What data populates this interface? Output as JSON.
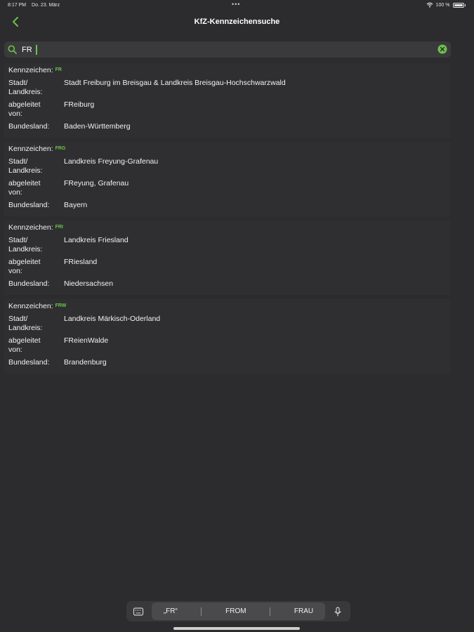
{
  "status_bar": {
    "time": "8:17 PM",
    "date": "Do. 23. März",
    "dots": "•••",
    "battery": "100 %"
  },
  "nav": {
    "title": "KfZ-Kennzeichensuche"
  },
  "search": {
    "value": "FR"
  },
  "labels": {
    "kennzeichen": "Kennzeichen:",
    "stadt_line1": "Stadt/",
    "stadt_line2": "Landkreis:",
    "abgeleitet_line1": "abgeleitet",
    "abgeleitet_line2": "von:",
    "bundesland": "Bundesland:"
  },
  "results": [
    {
      "code": "FR",
      "stadt": "Stadt Freiburg im Breisgau & Landkreis Breisgau-Hochschwarzwald",
      "abgeleitet": "FReiburg",
      "bundesland": "Baden-Württemberg"
    },
    {
      "code": "FRG",
      "stadt": "Landkreis Freyung-Grafenau",
      "abgeleitet": "FReyung, Grafenau",
      "bundesland": "Bayern"
    },
    {
      "code": "FRI",
      "stadt": "Landkreis Friesland",
      "abgeleitet": "FRiesland",
      "bundesland": "Niedersachsen"
    },
    {
      "code": "FRW",
      "stadt": "Landkreis Märkisch-Oderland",
      "abgeleitet": "FReienWalde",
      "bundesland": "Brandenburg"
    }
  ],
  "keyboard": {
    "suggestions": [
      "„FR“",
      "FROM",
      "FRAU"
    ]
  },
  "colors": {
    "accent": "#6cc24a",
    "background": "#2c2c2e",
    "search_bg": "#3a3a3c"
  },
  "icons": [
    "back-chevron-icon",
    "search-icon",
    "clear-icon",
    "wifi-icon",
    "battery-icon",
    "keyboard-icon",
    "microphone-icon"
  ]
}
